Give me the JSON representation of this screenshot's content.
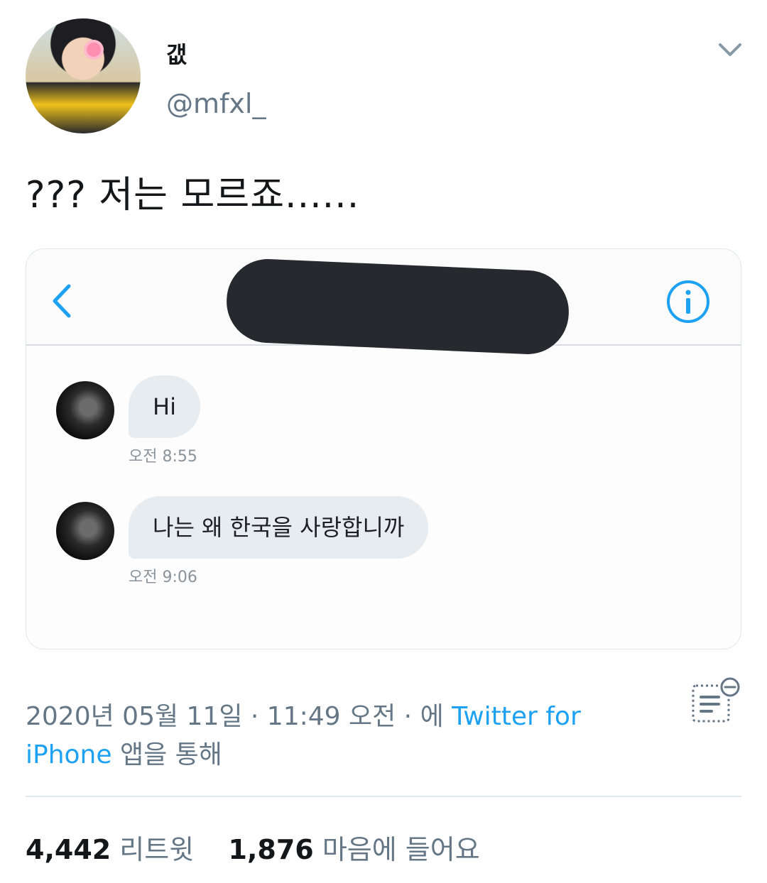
{
  "header": {
    "display_name": "갮",
    "handle": "@mfxl_"
  },
  "tweet": {
    "text": "??? 저는 모르죠......"
  },
  "dm_screenshot": {
    "messages": [
      {
        "text": "Hi",
        "time": "오전 8:55"
      },
      {
        "text": "나는 왜 한국을 사랑합니까",
        "time": "오전 9:06"
      }
    ],
    "icons": [
      "back-icon",
      "info-icon"
    ],
    "accent": "#1da1f2"
  },
  "meta": {
    "timestamp": "2020년 05월 11일 · 11:49 오전 · 에",
    "source": "Twitter for iPhone",
    "source_suffix": "앱을 통해"
  },
  "stats": {
    "retweets_count": "4,442",
    "retweets_label": "리트윗",
    "likes_count": "1,876",
    "likes_label": "마음에 들어요"
  },
  "colors": {
    "link": "#1da1f2",
    "secondary_text": "#657786",
    "primary_text": "#14171a"
  }
}
